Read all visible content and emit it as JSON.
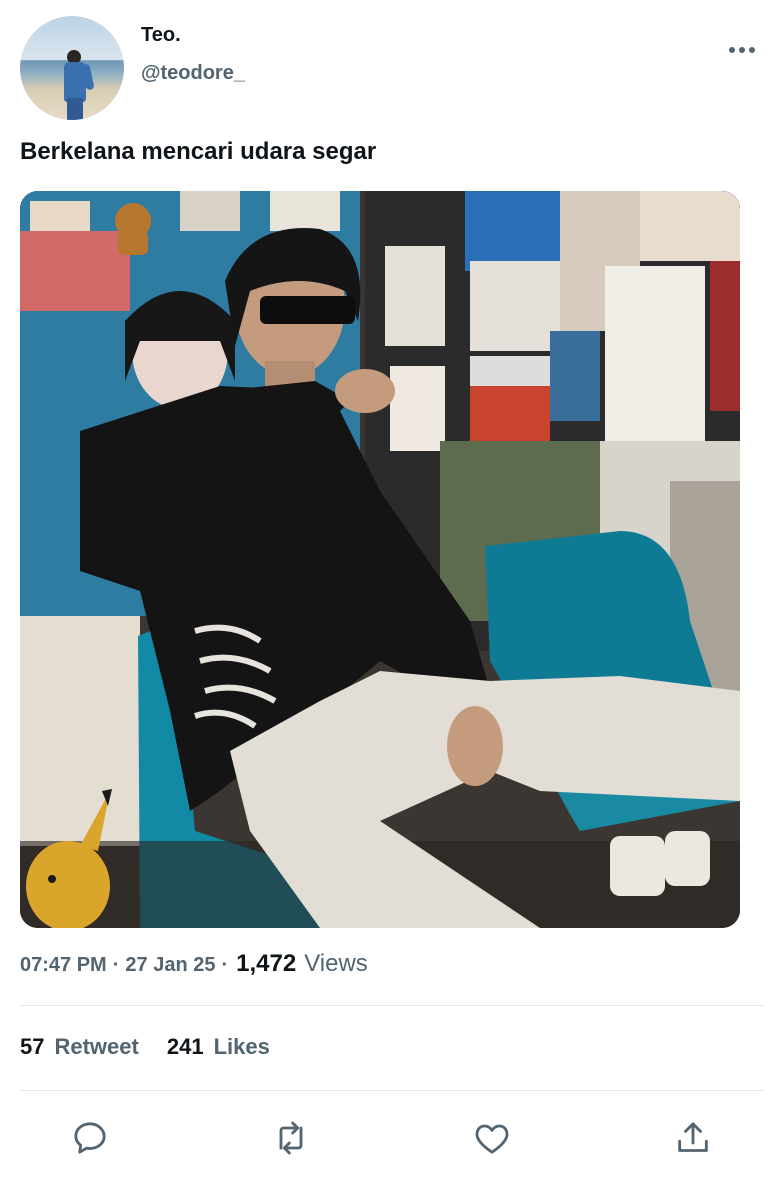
{
  "user": {
    "display_name": "Teo.",
    "handle": "@teodore_",
    "avatar_icon": "avatar-photo"
  },
  "tweet": {
    "text": "Berkelana mencari udara segar",
    "media_description": "photo-placeholder"
  },
  "meta": {
    "time": "07:47 PM",
    "date": "27 Jan 25",
    "views_count": "1,472",
    "views_label": "Views"
  },
  "stats": {
    "retweet_count": "57",
    "retweet_label": "Retweet",
    "likes_count": "241",
    "likes_label": "Likes"
  },
  "actions": [
    {
      "name": "reply",
      "icon": "speech-bubble-icon"
    },
    {
      "name": "retweet",
      "icon": "retweet-arrows-icon"
    },
    {
      "name": "like",
      "icon": "heart-icon"
    },
    {
      "name": "share",
      "icon": "share-upload-icon"
    }
  ],
  "colors": {
    "primary_text": "#0f1419",
    "secondary_text": "#536471",
    "divider": "#e6e9eb"
  }
}
